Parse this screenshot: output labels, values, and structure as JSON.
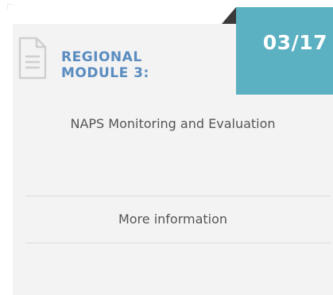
{
  "card": {
    "date": "03/17",
    "icon": "document-icon",
    "module_label_line1": "REGIONAL",
    "module_label_line2": "MODULE 3:",
    "title": "NAPS Monitoring and Evaluation",
    "more_link": "More information"
  },
  "colors": {
    "badge": "#5bb0c1",
    "module_label": "#5a8cc0",
    "card_bg": "#f3f3f3",
    "text": "#555555",
    "fold": "#3a3a3a"
  }
}
